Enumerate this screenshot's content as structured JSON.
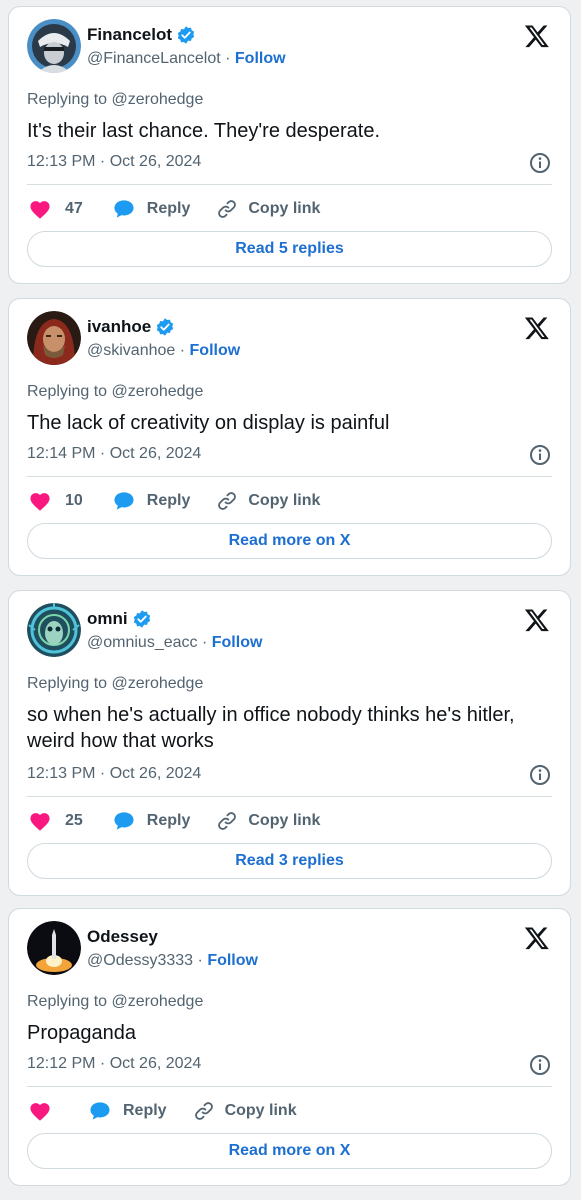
{
  "colors": {
    "like": "#f91880",
    "reply": "#1d9bf0",
    "link": "#1d6fd1",
    "secondary_text": "#536471",
    "verified": "#1d9bf0"
  },
  "tweets": [
    {
      "name": "Financelot",
      "verified": true,
      "handle": "@FinanceLancelot",
      "follow": "Follow",
      "replying_to": "Replying to @zerohedge",
      "text": "It's their last chance. They're desperate.",
      "timestamp": "12:13 PM · Oct 26, 2024",
      "likes": "47",
      "reply_label": "Reply",
      "copy_label": "Copy link",
      "read_label": "Read 5 replies"
    },
    {
      "name": "ivanhoe",
      "verified": true,
      "handle": "@skivanhoe",
      "follow": "Follow",
      "replying_to": "Replying to @zerohedge",
      "text": "The lack of creativity on display is painful",
      "timestamp": "12:14 PM · Oct 26, 2024",
      "likes": "10",
      "reply_label": "Reply",
      "copy_label": "Copy link",
      "read_label": "Read more on X"
    },
    {
      "name": "omni",
      "verified": true,
      "handle": "@omnius_eacc",
      "follow": "Follow",
      "replying_to": "Replying to @zerohedge",
      "text": "so when he's actually in office nobody thinks he's hitler, weird how that works",
      "timestamp": "12:13 PM · Oct 26, 2024",
      "likes": "25",
      "reply_label": "Reply",
      "copy_label": "Copy link",
      "read_label": "Read 3 replies"
    },
    {
      "name": "Odessey",
      "verified": false,
      "handle": "@Odessy3333",
      "follow": "Follow",
      "replying_to": "Replying to @zerohedge",
      "text": "Propaganda",
      "timestamp": "12:12 PM · Oct 26, 2024",
      "likes": "",
      "reply_label": "Reply",
      "copy_label": "Copy link",
      "read_label": "Read more on X"
    }
  ],
  "icons": {
    "close": "x-logo-icon",
    "verified": "verified-badge-icon",
    "info": "info-icon",
    "like": "heart-icon",
    "reply": "speech-bubble-icon",
    "copy": "link-icon"
  }
}
